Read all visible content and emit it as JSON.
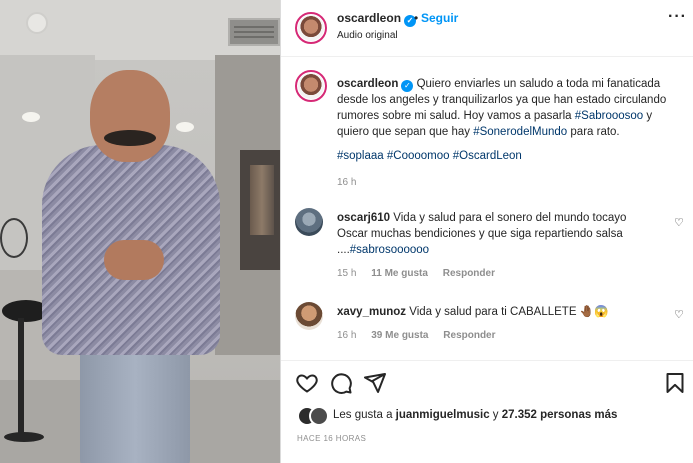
{
  "post": {
    "username": "oscardleon",
    "follow_label": "Seguir",
    "separator": "•",
    "audio": "Audio original",
    "more_label": "···"
  },
  "caption": {
    "username": "oscardleon",
    "text_1": "Quiero enviarles un saludo a toda mi fanaticada desde los angeles y tranquilizarlos ya que han estado circulando rumores sobre mi salud. Hoy vamos a pasarla ",
    "tag_1": "#Sabrooosoo",
    "text_2": " y quiero que sepan que hay ",
    "tag_2": "#SonerodelMundo",
    "text_3": " para rato.",
    "hashtags": [
      "#soplaaa",
      "#Coooomoo",
      "#OscardLeon"
    ],
    "time": "16 h"
  },
  "comments": [
    {
      "username": "oscarj610",
      "text": "Vida y salud para el sonero del mundo tocayo Oscar muchas bendiciones y que siga repartiendo salsa ....",
      "tag": "#sabrosoooooo",
      "time": "15 h",
      "likes": "11 Me gusta",
      "reply": "Responder"
    },
    {
      "username": "xavy_munoz",
      "text": "Vida y salud para ti CABALLETE ",
      "emoji": "🤚🏾😱",
      "time": "16 h",
      "likes": "39 Me gusta",
      "reply": "Responder"
    }
  ],
  "likes": {
    "prefix": "Les gusta a ",
    "user": "juanmiguelmusic",
    "middle": " y ",
    "count": "27.352 personas más"
  },
  "ago": "HACE 16 HORAS",
  "icons": [
    "heart-icon",
    "comment-icon",
    "share-icon",
    "bookmark-icon",
    "verified-icon",
    "more-icon"
  ],
  "colors": {
    "link": "#0095f6",
    "hashtag": "#00376b",
    "muted": "#8e8e8e",
    "ring": "#d62976"
  }
}
